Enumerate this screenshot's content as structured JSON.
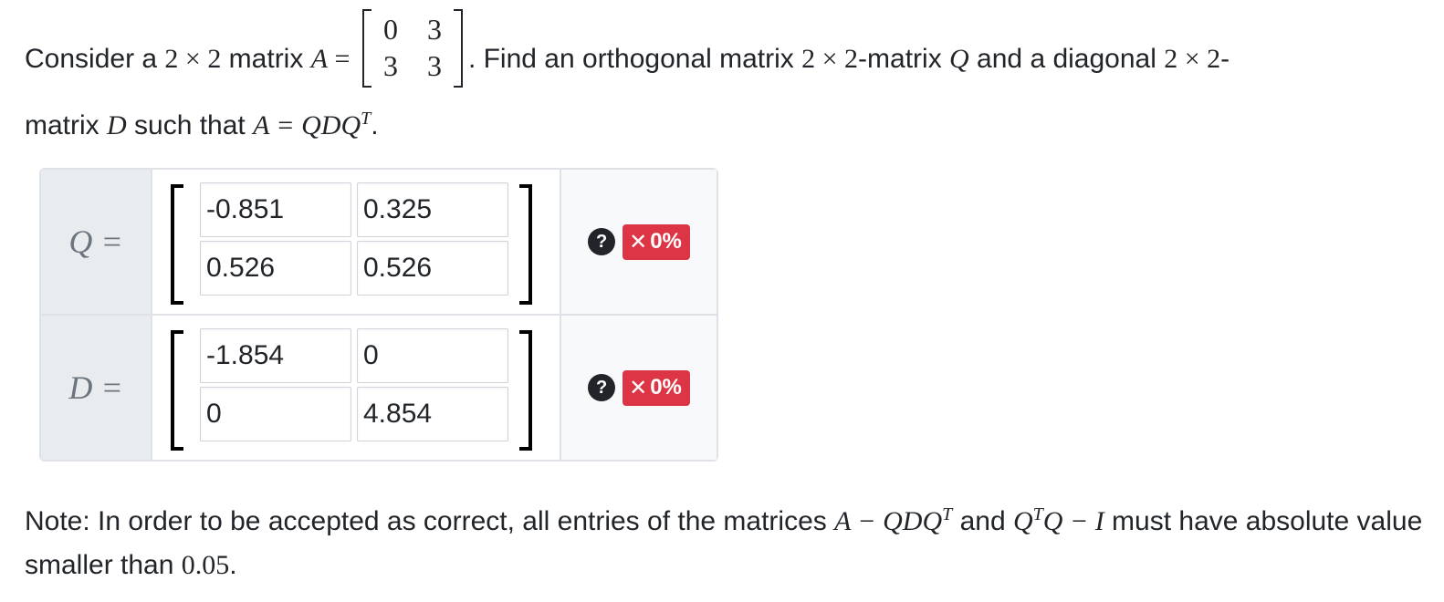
{
  "prompt": {
    "t1": "Consider a ",
    "dim1": "2 × 2",
    "t2": " matrix ",
    "A": "A",
    "eq": " = ",
    "matrix_A": [
      "0",
      "3",
      "3",
      "3"
    ],
    "t3": ". Find an orthogonal matrix ",
    "dim2": "2 × 2",
    "t4": "-matrix ",
    "Q": "Q",
    "t5": " and a diagonal ",
    "dim3": "2 × 2",
    "t6": "-",
    "t7": "matrix ",
    "D": "D",
    "t8": " such that ",
    "formula": "A = QDQ",
    "sup": "T",
    "t9": "."
  },
  "answers": {
    "Q": {
      "label": "Q =",
      "values": [
        "-0.851",
        "0.325",
        "0.526",
        "0.526"
      ],
      "help": "?",
      "score": "0%",
      "score_icon": "✕"
    },
    "D": {
      "label": "D =",
      "values": [
        "-1.854",
        "0",
        "0",
        "4.854"
      ],
      "help": "?",
      "score": "0%",
      "score_icon": "✕"
    }
  },
  "note": {
    "t1": "Note: In order to be accepted as correct, all entries of the matrices ",
    "m1": "A − QDQ",
    "s1": "T",
    "t2": " and ",
    "m2a": "Q",
    "s2": "T",
    "m2b": "Q − I",
    "t3": " must have absolute value smaller than ",
    "m3": "0.05",
    "t4": "."
  },
  "colors": {
    "badge": "#dc3545",
    "label_bg": "#e9ecef",
    "status_bg": "#f8f9fa",
    "border": "#dee2e6"
  }
}
